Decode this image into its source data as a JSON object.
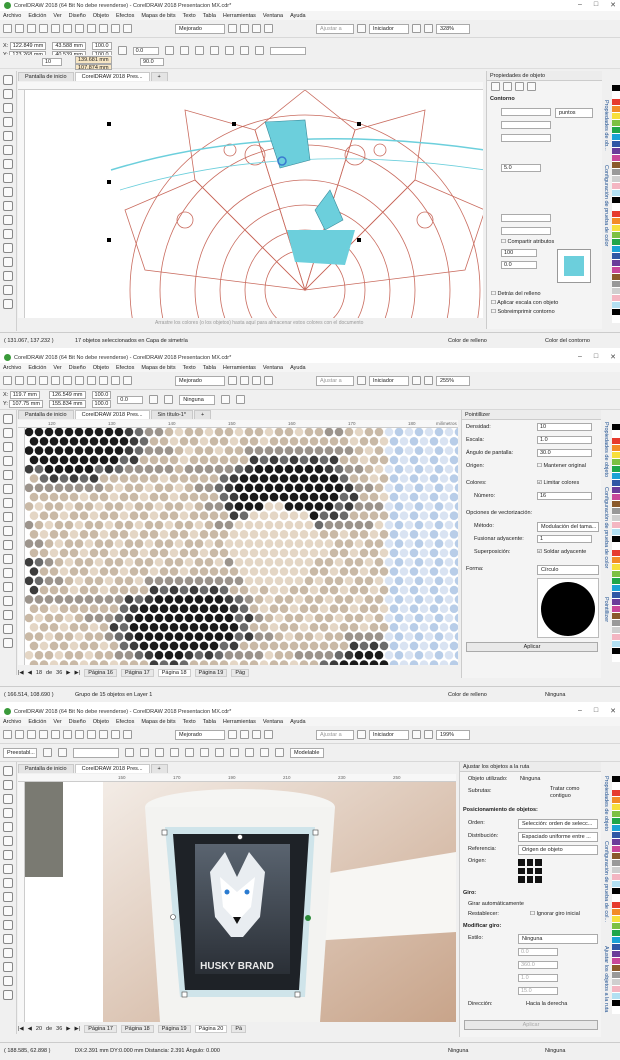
{
  "app": {
    "menu": [
      "Archivo",
      "Edición",
      "Ver",
      "Diseño",
      "Objeto",
      "Efectos",
      "Mapas de bits",
      "Texto",
      "Tabla",
      "Herramientas",
      "Ventana",
      "Ayuda"
    ]
  },
  "shot1": {
    "title": "CorelDRAW 2018 (64 Bit No debe revenderse) - CorelDRAW 2018 Presentacion MX.cdr*",
    "std": {
      "quality": "Mejorado",
      "snap": "Ajustar a",
      "launcher": "Iniciador",
      "zoom": "328%"
    },
    "prop": {
      "x": "122.849 mm",
      "y": "123.268 mm",
      "w": "43.588 mm",
      "h": "40.539 mm",
      "sx": "100.0",
      "sy": "100.0",
      "pct": "%",
      "rot": "0.0",
      "corner": "10",
      "dx": "139.681 mm",
      "dy": "107.874 mm",
      "angle": "90.0",
      "units": "%"
    },
    "tabs": [
      "Pantalla de inicio",
      "CorelDRAW 2018 Pres..."
    ],
    "docker": {
      "title": "Propiedades de objeto",
      "section": "Contorno",
      "width_unit": "puntos",
      "miter": "5.0",
      "size_w": "100",
      "size_h": "0.0",
      "compartir": "Compartir atributos",
      "detras": "Detrás del relleno",
      "escala": "Aplicar escala con objeto",
      "sobre": "Sobreimprimir contorno",
      "tabs_vertical": [
        "Propiedades de ob...",
        "Configuración de prueba de color"
      ]
    },
    "canvas_hint": "Arrastre los colores (o los objetos) hasta aquí para almacenar estos colores con el documento",
    "status": {
      "coords": "( 131.067, 137.232 )",
      "selection": "17 objetos seleccionados en Capa de simetría",
      "fill": "Color de relleno",
      "outline": "Color del contorno"
    }
  },
  "shot2": {
    "title": "CorelDRAW 2018 (64 Bit No debe revenderse) - CorelDRAW 2018 Presentacion MX.cdr*",
    "std": {
      "quality": "Mejorado",
      "snap": "Ajustar a",
      "launcher": "Iniciador",
      "zoom": "255%"
    },
    "prop": {
      "x": "119.7 mm",
      "y": "107.75 mm",
      "w": "126.549 mm",
      "h": "155.834 mm",
      "sx": "100.0",
      "sy": "100.0",
      "rot": "0.0",
      "outline": "Ninguna"
    },
    "tabs": [
      "Pantalla de inicio",
      "CorelDRAW 2018 Pres...",
      "Sin título-1*"
    ],
    "ruler_unit": "milímetros",
    "ruler_ticks": [
      "120",
      "130",
      "140",
      "150",
      "160",
      "170",
      "180"
    ],
    "docker": {
      "title": "Pointillizer",
      "densidad_label": "Densidad:",
      "densidad": "10",
      "escala_label": "Escala:",
      "escala": "1.0",
      "angulo_label": "Ángulo de pantalla:",
      "angulo": "30.0",
      "origen_label": "Origen:",
      "mantener": "Mantener original",
      "colores_label": "Colores:",
      "limitar": "Limitar colores",
      "numero_label": "Número:",
      "numero": "16",
      "opciones": "Opciones de vectorización:",
      "metodo_label": "Método:",
      "metodo": "Modulación del tama...",
      "fusionar_label": "Fusionar adyacente:",
      "fusionar": "1",
      "superposicion_label": "Superposición:",
      "soldar": "Soldar adyacente",
      "forma_label": "Forma:",
      "forma": "Círculo",
      "aplicar": "Aplicar",
      "tabs_vertical": [
        "Propiedades de objeto",
        "Configuración de prueba de color",
        "Pointillizer"
      ]
    },
    "pages": {
      "current": "18",
      "of": "de",
      "total": "36",
      "list": [
        "Página 16",
        "Página 17",
        "Página 18",
        "Página 19",
        "Pág"
      ]
    },
    "status": {
      "coords": "( 166.514, 108.690 )",
      "selection": "Grupo de 15 objetos en Layer 1",
      "fill": "Color de relleno",
      "outline": "Ninguna"
    }
  },
  "shot3": {
    "title": "CorelDRAW 2018 (64 Bit No debe revenderse) - CorelDRAW 2018 Presentacion MX.cdr*",
    "std": {
      "quality": "Mejorado",
      "snap": "Ajustar a",
      "launcher": "Iniciador",
      "zoom": "199%"
    },
    "prop": {
      "preset": "Preestabl...",
      "mode": "Modelable"
    },
    "tabs": [
      "Pantalla de inicio",
      "CorelDRAW 2018 Pres..."
    ],
    "ruler_ticks": [
      "150",
      "170",
      "190",
      "210",
      "230",
      "250"
    ],
    "brand": "HUSKY BRAND",
    "docker": {
      "title": "Ajustar los objetos a la ruta",
      "obj_label": "Objeto utilizado:",
      "obj": "Ninguna",
      "sub_label": "Subrutas:",
      "sub": "Tratar como contiguo",
      "pos_title": "Posicionamiento de objetos:",
      "orden_label": "Orden:",
      "orden": "Selección: orden de selecc...",
      "dist_label": "Distribución:",
      "dist": "Espaciado uniforme entre ...",
      "ref_label": "Referencia:",
      "ref": "Origen de objeto",
      "origen_label": "Origen:",
      "giro_title": "Giro:",
      "giro_auto": "Girar automáticamente",
      "restablecer": "Restablecer:",
      "ignorar": "Ignorar giro inicial",
      "mod_title": "Modificar giro:",
      "estilo_label": "Estilo:",
      "estilo": "Ninguna",
      "val1": "0.0",
      "val2": "360.0",
      "val3": "1.0",
      "val4": "15.0",
      "dir_label": "Dirección:",
      "dir": "Hacia la derecha",
      "aplicar": "Aplicar",
      "tabs_vertical": [
        "Propiedades de objeto",
        "Configuración de prueba de col...",
        "Ajustar los objetos a la ruta"
      ]
    },
    "pages": {
      "current": "20",
      "of": "de",
      "total": "36",
      "list": [
        "Página 17",
        "Página 18",
        "Página 19",
        "Página 20",
        "Pá"
      ]
    },
    "status": {
      "coords": "( 188.585, 62.898 )",
      "dist": "DX:2.391 mm DY:0.000 mm Distancia: 2.391 Ángulo: 0.000",
      "fill": "Ninguna",
      "outline": "Ninguna"
    }
  },
  "colors": {
    "accent": "#6ccfdc",
    "mandala": "#c96b5e",
    "palette": [
      "#000000",
      "#ffffff",
      "#e63b2e",
      "#f28c28",
      "#f7e03c",
      "#7cc142",
      "#1fa64a",
      "#1aa2d6",
      "#2f57a5",
      "#6a3c9a",
      "#c8479a",
      "#8b5a2b",
      "#999999",
      "#cfcfcf",
      "#f4b6c2",
      "#b3e0f2"
    ]
  }
}
